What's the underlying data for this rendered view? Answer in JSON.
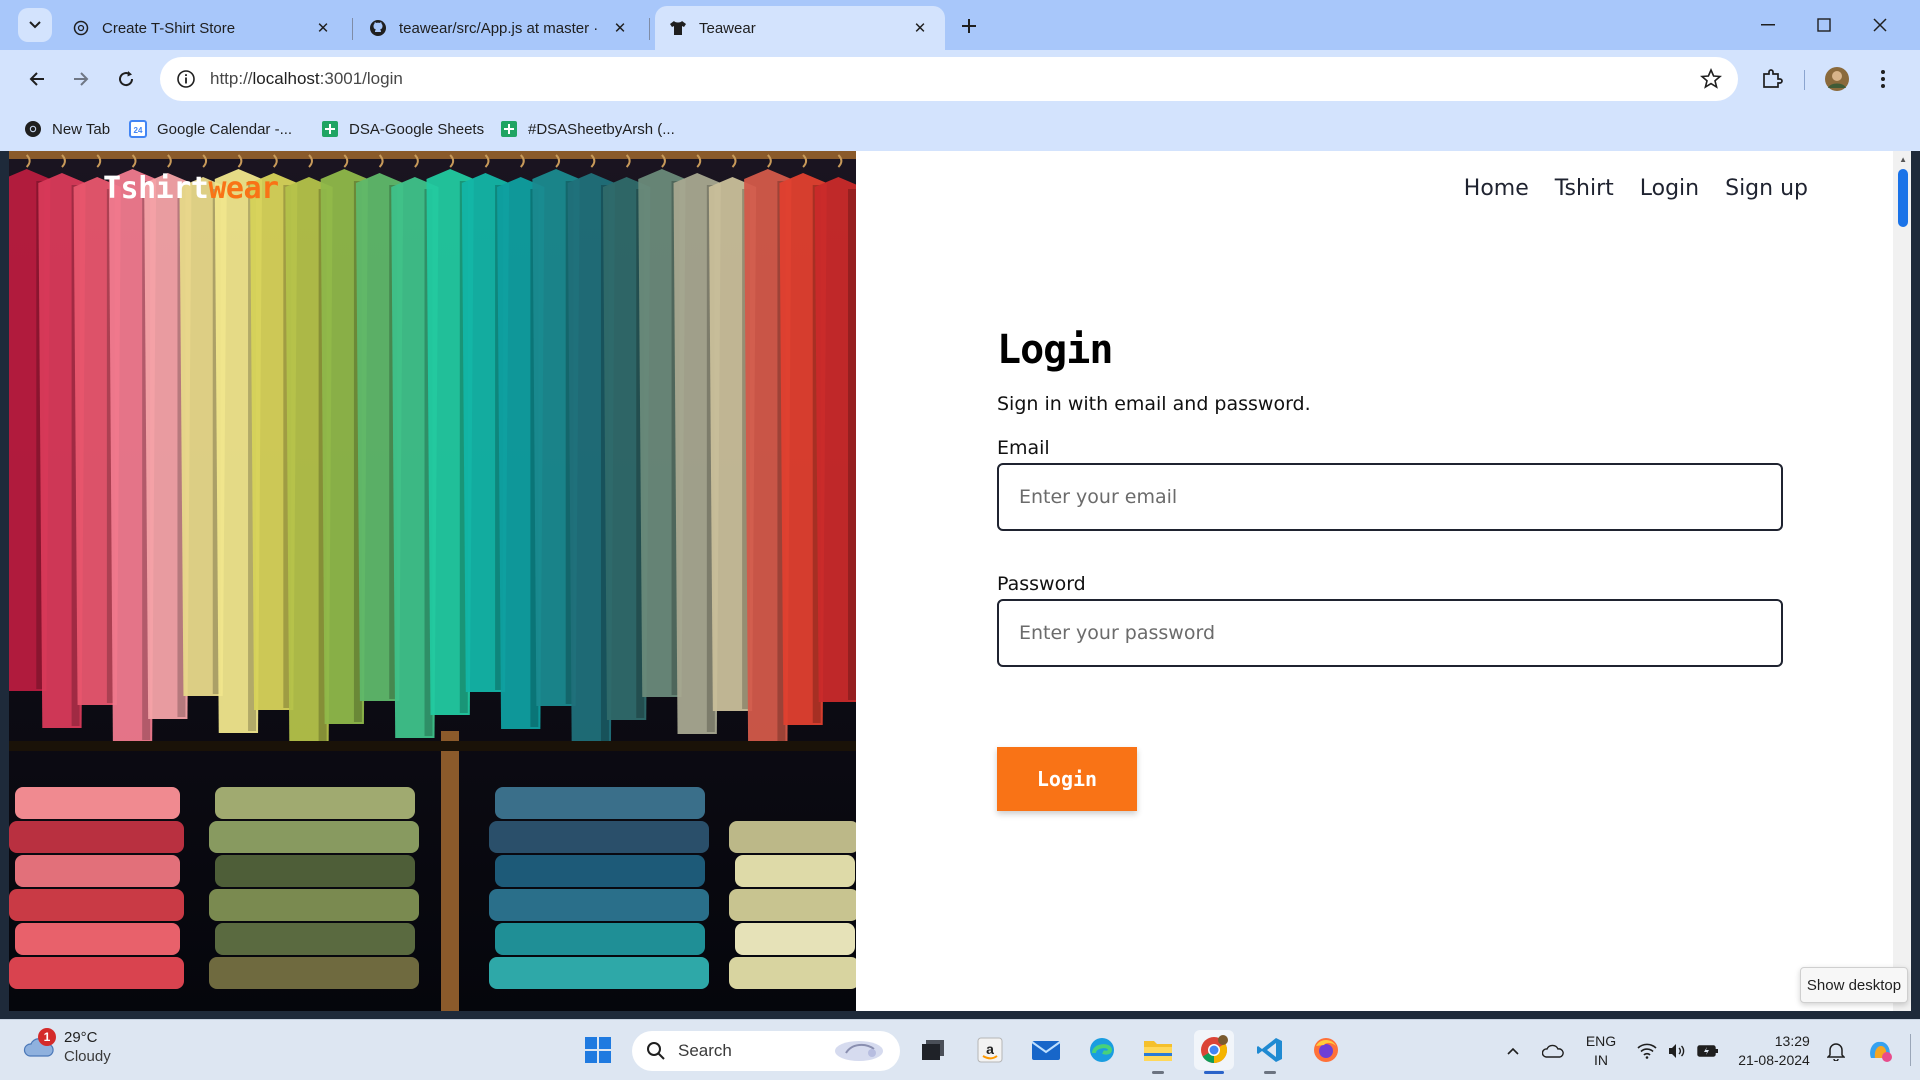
{
  "browser": {
    "tabs": [
      {
        "title": "Create T-Shirt Store",
        "favicon": "chatgpt-icon"
      },
      {
        "title": "teawear/src/App.js at master · ",
        "favicon": "github-icon"
      },
      {
        "title": "Teawear",
        "favicon": "tshirt-icon"
      }
    ],
    "url_prefix": "http://",
    "url_host": "localhost",
    "url_rest": ":3001/login",
    "bookmarks": [
      {
        "label": "New Tab",
        "icon": "chrome-icon"
      },
      {
        "label": "Google Calendar -...",
        "icon": "calendar-icon",
        "icon_text": "24"
      },
      {
        "label": "DSA-Google Sheets",
        "icon": "sheets-icon"
      },
      {
        "label": "#DSASheetbyArsh (...",
        "icon": "sheets-icon"
      }
    ]
  },
  "page": {
    "brand": {
      "part1": "Tshirt",
      "part2": "wear"
    },
    "nav": [
      "Home",
      "Tshirt",
      "Login",
      "Sign up"
    ],
    "login": {
      "title": "Login",
      "subtitle": "Sign in with email and password.",
      "email_label": "Email",
      "email_placeholder": "Enter your email",
      "password_label": "Password",
      "password_placeholder": "Enter your password",
      "button": "Login"
    },
    "colors": {
      "accent": "#f97316",
      "text": "#1f2330"
    }
  },
  "taskbar": {
    "weather": {
      "temp": "29°C",
      "condition": "Cloudy",
      "badge": "1"
    },
    "search_label": "Search",
    "lang": {
      "line1": "ENG",
      "line2": "IN"
    },
    "clock": {
      "time": "13:29",
      "date": "21-08-2024"
    },
    "tooltip": "Show desktop"
  }
}
